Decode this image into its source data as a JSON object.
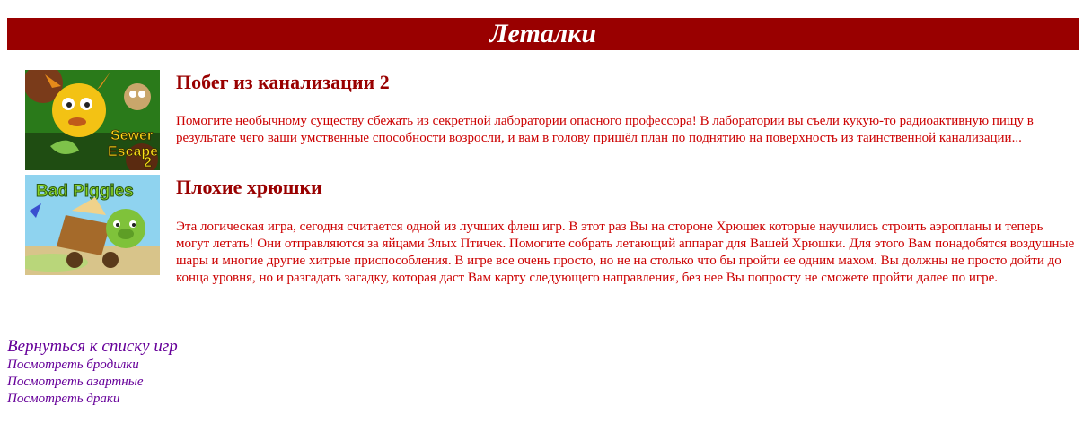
{
  "page": {
    "title": "Леталки"
  },
  "games": [
    {
      "title": "Побег из канализации 2",
      "description": "Помогите необычному существу сбежать из секретной лаборатории опасного профессора! В лаборатории вы съели кукую-то радиоактивную пищу в результате чего ваши умственные способности возросли, и вам в голову пришёл план по поднятию на поверхность из таинственной канализации...",
      "thumb_text_line1": "Sewer",
      "thumb_text_line2": "Escape",
      "thumb_text_num": "2"
    },
    {
      "title": "Плохие хрюшки",
      "description": "Эта логическая игра, сегодня считается одной из лучших флеш игр. В этот раз Вы на стороне Хрюшек которые научились строить аэропланы и теперь могут летать! Они отправляются за яйцами Злых Птичек. Помогите собрать летающий аппарат для Вашей Хрюшки. Для этого Вам понадобятся воздушные шары и многие другие хитрые приспособления. В игре все очень просто, но не на столько что бы пройти ее одним махом. Вы должны не просто дойти до конца уровня, но и разгадать загадку, которая даст Вам карту следующего направления, без нее Вы попросту не сможете пройти далее по игре.",
      "thumb_text_line1": "Bad Piggies"
    }
  ],
  "links": {
    "back": "Вернуться к списку игр",
    "items": [
      "Посмотреть бродилки",
      "Посмотреть азартные",
      "Посмотреть драки"
    ]
  },
  "colors": {
    "header_bg": "#990000",
    "title": "#990000",
    "description": "#cc0000",
    "link": "#660099"
  }
}
